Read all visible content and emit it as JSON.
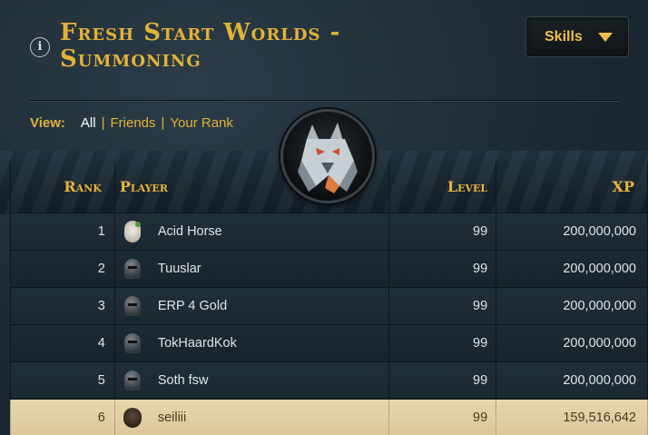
{
  "header": {
    "title": "Fresh Start Worlds - Summoning",
    "info_icon": "i",
    "skills_button": "Skills"
  },
  "view": {
    "label": "View:",
    "options": [
      "All",
      "Friends",
      "Your Rank"
    ],
    "active": "All",
    "separator": "|"
  },
  "skill_icon": "wolf-icon",
  "table": {
    "headers": {
      "rank": "Rank",
      "player": "Player",
      "level": "Level",
      "xp": "XP"
    },
    "rows": [
      {
        "rank": "1",
        "player": "Acid Horse",
        "level": "99",
        "xp": "200,000,000",
        "avatar": "face"
      },
      {
        "rank": "2",
        "player": "Tuuslar",
        "level": "99",
        "xp": "200,000,000",
        "avatar": "helm"
      },
      {
        "rank": "3",
        "player": "ERP 4 Gold",
        "level": "99",
        "xp": "200,000,000",
        "avatar": "helm"
      },
      {
        "rank": "4",
        "player": "TokHaardKok",
        "level": "99",
        "xp": "200,000,000",
        "avatar": "helm"
      },
      {
        "rank": "5",
        "player": "Soth fsw",
        "level": "99",
        "xp": "200,000,000",
        "avatar": "helm"
      },
      {
        "rank": "6",
        "player": "seiliii",
        "level": "99",
        "xp": "159,516,642",
        "avatar": "dark",
        "highlighted": true
      }
    ]
  },
  "colors": {
    "gold_accent": "#e2b238",
    "highlight_row": "#e8d6ae",
    "background": "#1e2b34"
  }
}
